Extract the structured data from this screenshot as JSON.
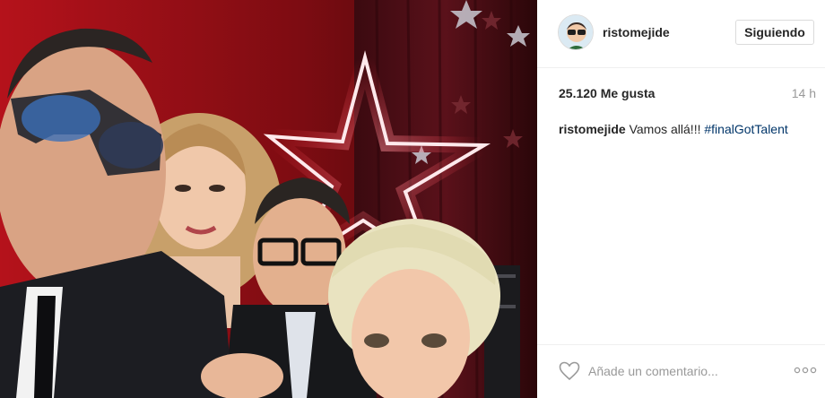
{
  "post": {
    "image_description": "",
    "username": "ristomejide",
    "follow_label": "Siguiendo",
    "likes": "25.120 Me gusta",
    "time": "14 h",
    "caption": {
      "username": "ristomejide",
      "text": "Vamos allá!!!",
      "hashtag": "#finalGotTalent"
    },
    "comment_placeholder": "Añade un comentario...",
    "icons": {
      "like": "heart-outline-icon",
      "more": "more-options-icon"
    },
    "colors": {
      "hashtag": "#003569",
      "muted": "#999999",
      "border": "#dbdbdb"
    }
  }
}
